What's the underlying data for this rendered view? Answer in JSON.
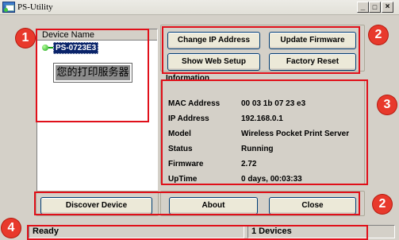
{
  "window": {
    "title": "PS-Utility"
  },
  "window_controls": [
    "_",
    "□",
    "×"
  ],
  "device_list": {
    "header": "Device Name",
    "device": "PS-0723E3",
    "annotation_text": "您的打印服务器"
  },
  "actions": {
    "change_ip": "Change IP Address",
    "update_firmware": "Update Firmware",
    "web_setup": "Show Web Setup",
    "factory_reset": "Factory Reset",
    "discover": "Discover Device",
    "about": "About",
    "close": "Close"
  },
  "info": {
    "title": "Information",
    "rows": [
      {
        "label": "MAC Address",
        "value": "00 03 1b 07 23 e3"
      },
      {
        "label": "IP Address",
        "value": "192.168.0.1"
      },
      {
        "label": "Model",
        "value": "Wireless Pocket Print Server"
      },
      {
        "label": "Status",
        "value": "Running"
      },
      {
        "label": "Firmware",
        "value": "2.72"
      },
      {
        "label": "UpTime",
        "value": "0 days, 00:03:33"
      }
    ]
  },
  "status_bar": {
    "state": "Ready",
    "count": "1 Devices"
  },
  "markers": [
    "1",
    "2",
    "3",
    "2",
    "4"
  ],
  "colors": {
    "callout": "#e0101a",
    "selection": "#0a246a",
    "status_ok": "#17a317"
  }
}
